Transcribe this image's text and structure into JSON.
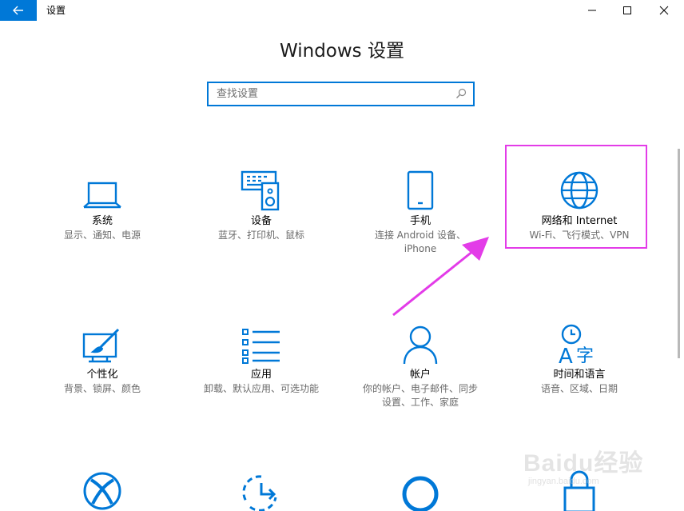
{
  "window": {
    "title": "设置"
  },
  "header": {
    "title": "Windows 设置"
  },
  "search": {
    "placeholder": "查找设置"
  },
  "tiles": [
    {
      "name": "系统",
      "desc": "显示、通知、电源",
      "icon": "laptop-icon"
    },
    {
      "name": "设备",
      "desc": "蓝牙、打印机、鼠标",
      "icon": "devices-icon"
    },
    {
      "name": "手机",
      "desc": "连接 Android 设备、\niPhone",
      "icon": "phone-icon"
    },
    {
      "name": "网络和 Internet",
      "desc": "Wi-Fi、飞行模式、VPN",
      "icon": "globe-icon"
    },
    {
      "name": "个性化",
      "desc": "背景、锁屏、颜色",
      "icon": "personalization-icon"
    },
    {
      "name": "应用",
      "desc": "卸载、默认应用、可选功能",
      "icon": "apps-list-icon"
    },
    {
      "name": "帐户",
      "desc": "你的帐户、电子邮件、同步\n设置、工作、家庭",
      "icon": "person-icon"
    },
    {
      "name": "时间和语言",
      "desc": "语音、区域、日期",
      "icon": "time-language-icon"
    },
    {
      "name": "",
      "desc": "",
      "icon": "xbox-icon"
    },
    {
      "name": "",
      "desc": "",
      "icon": "ease-of-access-icon"
    },
    {
      "name": "",
      "desc": "",
      "icon": "cortana-icon"
    },
    {
      "name": "",
      "desc": "",
      "icon": "privacy-lock-icon"
    }
  ],
  "watermark": {
    "text": "Baidu经验",
    "sub": "jingyan.baidu.com"
  },
  "colors": {
    "accent": "#0078d7",
    "highlight": "#e33ce8",
    "arrow": "#e33ce8"
  }
}
